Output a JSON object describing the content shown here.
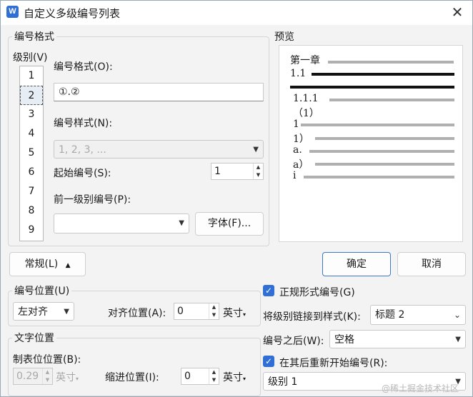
{
  "window": {
    "title": "自定义多级编号列表",
    "icon_letter": "W"
  },
  "numbering_format_group": {
    "legend": "编号格式",
    "level_label": "级别(V)",
    "levels": [
      "1",
      "2",
      "3",
      "4",
      "5",
      "6",
      "7",
      "8",
      "9"
    ],
    "selected_level": "2",
    "format_label": "编号格式(O):",
    "format_value": "①.②",
    "style_label": "编号样式(N):",
    "style_value": "1, 2, 3, ...",
    "start_label": "起始编号(S):",
    "start_value": "1",
    "prev_level_label": "前一级别编号(P):",
    "prev_level_value": "",
    "font_button": "字体(F)..."
  },
  "preview": {
    "legend": "预览",
    "lines": [
      "第一章",
      "1.1",
      "1.1.1",
      "（1）",
      "1",
      "1）",
      "a.",
      "a）",
      "i"
    ]
  },
  "buttons": {
    "general": "常规(L)",
    "ok": "确定",
    "cancel": "取消"
  },
  "number_position": {
    "legend": "编号位置(U)",
    "align_value": "左对齐",
    "align_pos_label": "对齐位置(A):",
    "align_pos_value": "0",
    "align_unit": "英寸"
  },
  "text_position": {
    "legend": "文字位置",
    "tab_label": "制表位位置(B):",
    "tab_value": "0.29",
    "tab_unit": "英寸",
    "indent_label": "缩进位置(I):",
    "indent_value": "0",
    "indent_unit": "英寸"
  },
  "right_options": {
    "legal_label": "正规形式编号(G)",
    "legal_checked": true,
    "link_label": "将级别链接到样式(K):",
    "link_value": "标题 2",
    "after_label": "编号之后(W):",
    "after_value": "空格",
    "restart_label": "在其后重新开始编号(R):",
    "restart_checked": true,
    "restart_value": "级别 1"
  },
  "watermark": "@稀土掘金技术社区"
}
